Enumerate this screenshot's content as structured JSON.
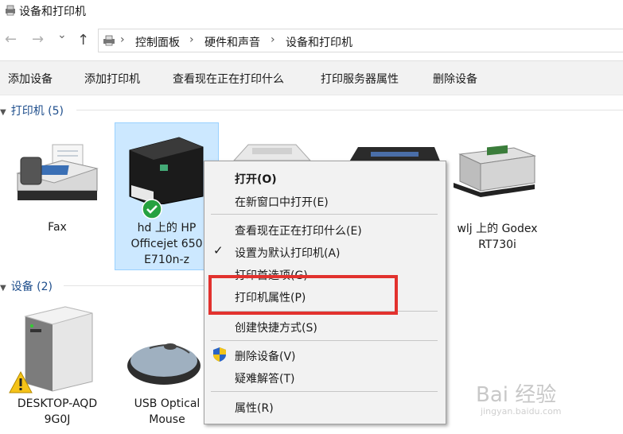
{
  "window": {
    "title": "设备和打印机"
  },
  "nav": {
    "back_icon": "←",
    "forward_icon": "→",
    "dropdown_icon": "⌄",
    "up_icon": "↑",
    "breadcrumb": [
      "控制面板",
      "硬件和声音",
      "设备和打印机"
    ],
    "separator": "›"
  },
  "toolbar": {
    "items": [
      "添加设备",
      "添加打印机",
      "查看现在正在打印什么",
      "打印服务器属性",
      "删除设备"
    ]
  },
  "printers": {
    "header": "打印机 (5)",
    "items": [
      {
        "label": "Fax"
      },
      {
        "label_lines": [
          "hd 上的 HP",
          "Officejet 650",
          "E710n-z"
        ]
      },
      {
        "label_lines": [
          "wlj 上的 Godex",
          "RT730i"
        ]
      }
    ]
  },
  "devices": {
    "header": "设备 (2)",
    "items": [
      {
        "label_lines": [
          "DESKTOP-AQD",
          "9G0J"
        ]
      },
      {
        "label_lines": [
          "USB Optical",
          "Mouse"
        ]
      }
    ]
  },
  "context_menu": {
    "items": [
      {
        "label": "打开(O)"
      },
      {
        "label": "在新窗口中打开(E)"
      },
      {
        "label": "查看现在正在打印什么(E)"
      },
      {
        "label": "设置为默认打印机(A)"
      },
      {
        "label": "打印首选项(G)"
      },
      {
        "label": "打印机属性(P)"
      },
      {
        "label": "创建快捷方式(S)"
      },
      {
        "label": "删除设备(V)"
      },
      {
        "label": "疑难解答(T)"
      },
      {
        "label": "属性(R)"
      }
    ],
    "check_icon": "✓"
  },
  "watermark": {
    "brand": "Bai 经验",
    "url": "jingyan.baidu.com"
  },
  "colors": {
    "selection": "#cce8ff",
    "highlight_box": "#e2322e",
    "group_header": "#1e4e8c"
  }
}
